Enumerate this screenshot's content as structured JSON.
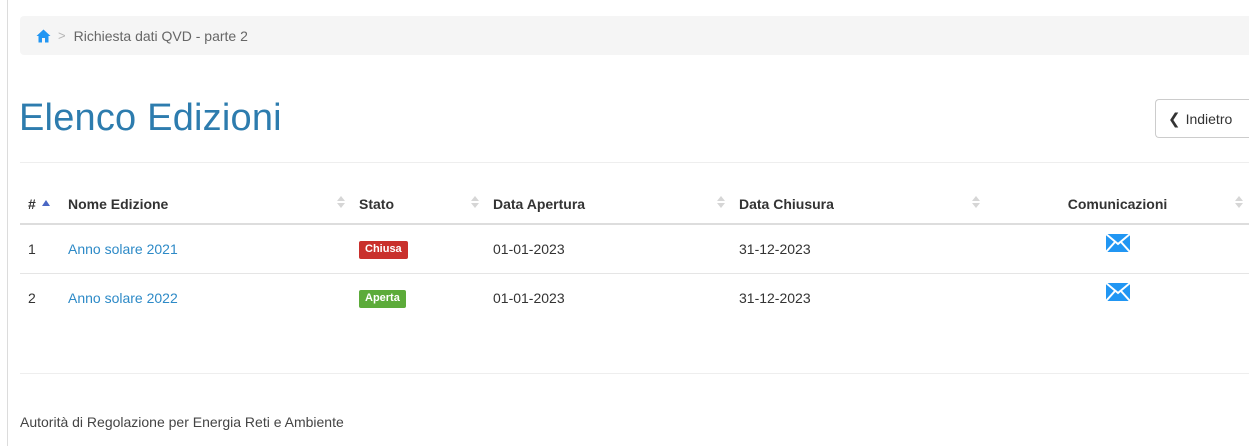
{
  "breadcrumb": {
    "home_icon": "home-icon",
    "separator": ">",
    "current": "Richiesta dati QVD - parte 2"
  },
  "page": {
    "title": "Elenco Edizioni",
    "back_button": {
      "label": "Indietro",
      "icon": "chevron-left-icon"
    }
  },
  "table": {
    "headers": [
      "#",
      "Nome Edizione",
      "Stato",
      "Data Apertura",
      "Data Chiusura",
      "Comunicazioni"
    ],
    "rows": [
      {
        "num": "1",
        "name": "Anno solare 2021",
        "status": "Chiusa",
        "status_color": "#c9302c",
        "open": "01-01-2023",
        "close": "31-12-2023",
        "comm_icon": "envelope-icon"
      },
      {
        "num": "2",
        "name": "Anno solare 2022",
        "status": "Aperta",
        "status_color": "#5cab3a",
        "open": "01-01-2023",
        "close": "31-12-2023",
        "comm_icon": "envelope-icon"
      }
    ]
  },
  "footer": {
    "text": "Autorità di Regolazione per Energia Reti e Ambiente"
  },
  "colors": {
    "title": "#2d7cae",
    "link": "#2d8ac7",
    "icon": "#2196f3"
  }
}
